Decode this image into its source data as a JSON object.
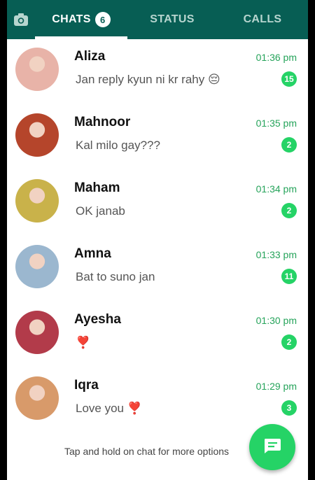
{
  "tabs": {
    "chats_label": "CHATS",
    "chats_badge": "6",
    "status_label": "STATUS",
    "calls_label": "CALLS"
  },
  "chats": [
    {
      "name": "Aliza",
      "message": "Jan reply kyun ni kr rahy 😔",
      "time": "01:36 pm",
      "unread": "15",
      "avatar_color": "#e8b3a8"
    },
    {
      "name": "Mahnoor",
      "message": "Kal milo gay???",
      "time": "01:35 pm",
      "unread": "2",
      "avatar_color": "#b5452b"
    },
    {
      "name": "Maham",
      "message": "OK janab",
      "time": "01:34 pm",
      "unread": "2",
      "avatar_color": "#c9b24a"
    },
    {
      "name": "Amna",
      "message": "Bat to suno jan",
      "time": "01:33 pm",
      "unread": "11",
      "avatar_color": "#9bb7cf"
    },
    {
      "name": "Ayesha",
      "message": "❣️",
      "time": "01:30 pm",
      "unread": "2",
      "avatar_color": "#b23b4a"
    },
    {
      "name": "Iqra",
      "message": "Love you ❣️",
      "time": "01:29 pm",
      "unread": "3",
      "avatar_color": "#d89a6a"
    }
  ],
  "hint": "Tap and hold on chat for more options",
  "colors": {
    "header": "#075e54",
    "accent": "#25d366",
    "time": "#25a35a"
  }
}
